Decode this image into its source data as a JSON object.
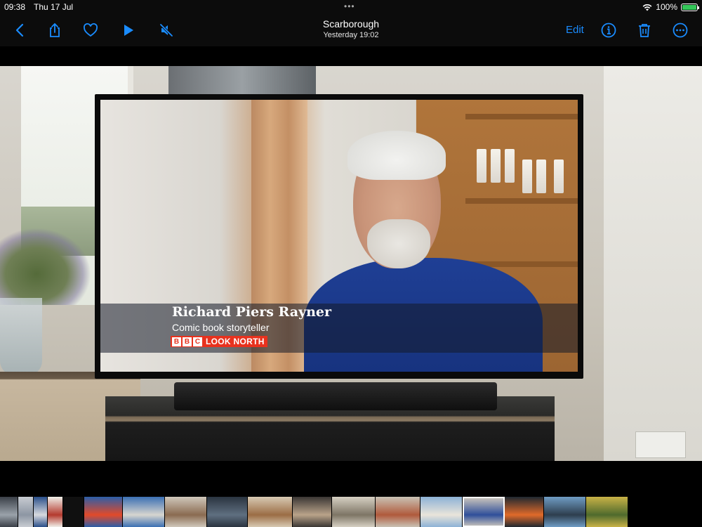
{
  "status_bar": {
    "time": "09:38",
    "date": "Thu 17 Jul",
    "more_dots": "•••",
    "battery_percent": "100%",
    "battery_level": 1.0
  },
  "nav": {
    "title": "Scarborough",
    "subtitle": "Yesterday  19:02",
    "edit_label": "Edit",
    "accent_color": "#1a8cff",
    "icons": [
      "chevron-left-icon",
      "share-icon",
      "heart-icon",
      "play-icon",
      "mute-icon",
      "info-icon",
      "trash-icon",
      "more-icon"
    ]
  },
  "tv_overlay": {
    "name": "Richard Piers Rayner",
    "role": "Comic book storyteller",
    "bbc_letters": [
      "B",
      "B",
      "C"
    ],
    "programme": "LOOK NORTH",
    "brand_color": "#e8321e"
  },
  "filmstrip": {
    "thumbnails": [
      {
        "color": "#3a3f47",
        "accent": "#9aa2aa"
      },
      {
        "color": "#c8ccd2",
        "accent": "#8d96a3"
      },
      {
        "color": "#2a4f8a",
        "accent": "#d7d9de"
      },
      {
        "color": "#f0efe9",
        "accent": "#b43a2e"
      },
      {
        "color": "#101010",
        "accent": "#101010"
      },
      {
        "color": "#2c5ea8",
        "accent": "#e24a2a"
      },
      {
        "color": "#3b6fb3",
        "accent": "#d7d5cf"
      },
      {
        "color": "#cfc7bb",
        "accent": "#8a6b51"
      },
      {
        "color": "#2a3440",
        "accent": "#5f6f80"
      },
      {
        "color": "#d7c9b3",
        "accent": "#9b6d45"
      },
      {
        "color": "#3a3634",
        "accent": "#b9a38a"
      },
      {
        "color": "#d6d0c3",
        "accent": "#7d7565"
      },
      {
        "color": "#c9c2b5",
        "accent": "#b05a3c"
      },
      {
        "color": "#8db2d6",
        "accent": "#e9e4da"
      },
      {
        "color": "#d2cbbe",
        "accent": "#2f4f9a"
      },
      {
        "color": "#1f2830",
        "accent": "#e06a2a"
      },
      {
        "color": "#6f9cc4",
        "accent": "#2e3e4e"
      },
      {
        "color": "#c9b247",
        "accent": "#4f6a2d"
      }
    ],
    "current_index": 14
  }
}
